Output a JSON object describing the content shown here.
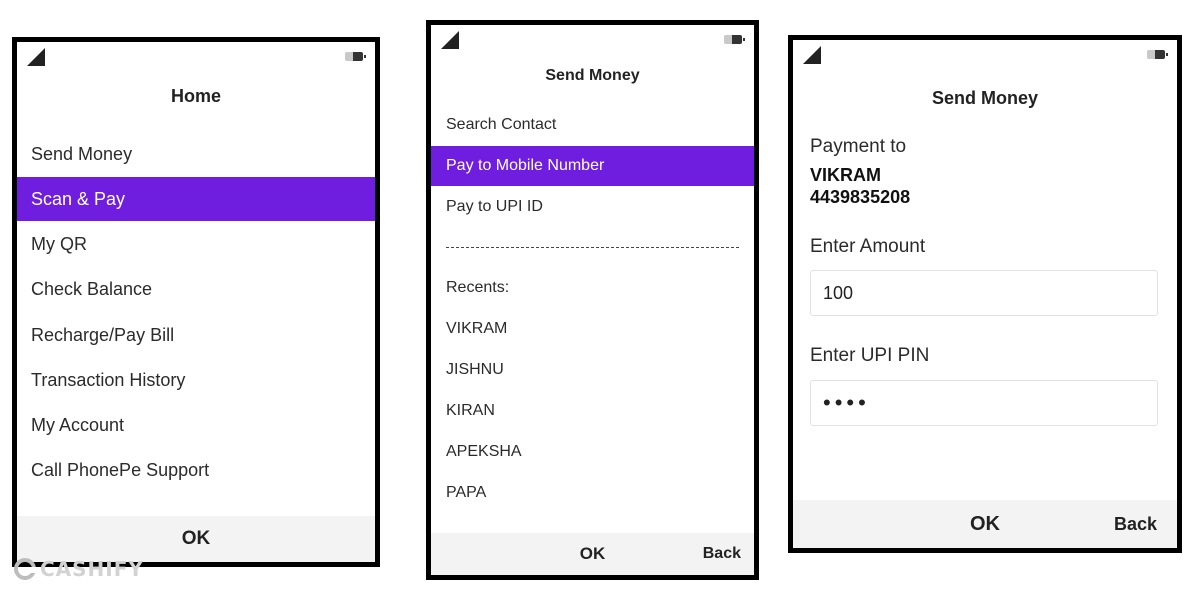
{
  "screen_home": {
    "title": "Home",
    "items": [
      {
        "label": "Send Money"
      },
      {
        "label": "Scan & Pay"
      },
      {
        "label": "My QR"
      },
      {
        "label": "Check Balance"
      },
      {
        "label": "Recharge/Pay Bill"
      },
      {
        "label": "Transaction History"
      },
      {
        "label": "My Account"
      },
      {
        "label": "Call PhonePe Support"
      }
    ],
    "selected_index": 1,
    "ok_label": "OK"
  },
  "screen_send_money": {
    "title": "Send Money",
    "items": [
      {
        "label": "Search Contact"
      },
      {
        "label": "Pay to Mobile Number"
      },
      {
        "label": "Pay to UPI ID"
      }
    ],
    "selected_index": 1,
    "recents_label": "Recents:",
    "recents": [
      "VIKRAM",
      "JISHNU",
      "KIRAN",
      "APEKSHA",
      "PAPA"
    ],
    "ok_label": "OK",
    "back_label": "Back"
  },
  "screen_payment": {
    "title": "Send Money",
    "payment_to_label": "Payment to",
    "payee_name": "VIKRAM",
    "payee_number": "4439835208",
    "amount_label": "Enter Amount",
    "amount_value": "100",
    "pin_label": "Enter UPI PIN",
    "pin_masked": "••••",
    "ok_label": "OK",
    "back_label": "Back"
  },
  "watermark": {
    "text": "CASHIFY"
  },
  "colors": {
    "accent": "#6f1ee0",
    "footer_bg": "#f3f3f3",
    "frame": "#000000"
  },
  "icons": [
    "signal-icon",
    "battery-icon",
    "cashify-logo-icon"
  ]
}
